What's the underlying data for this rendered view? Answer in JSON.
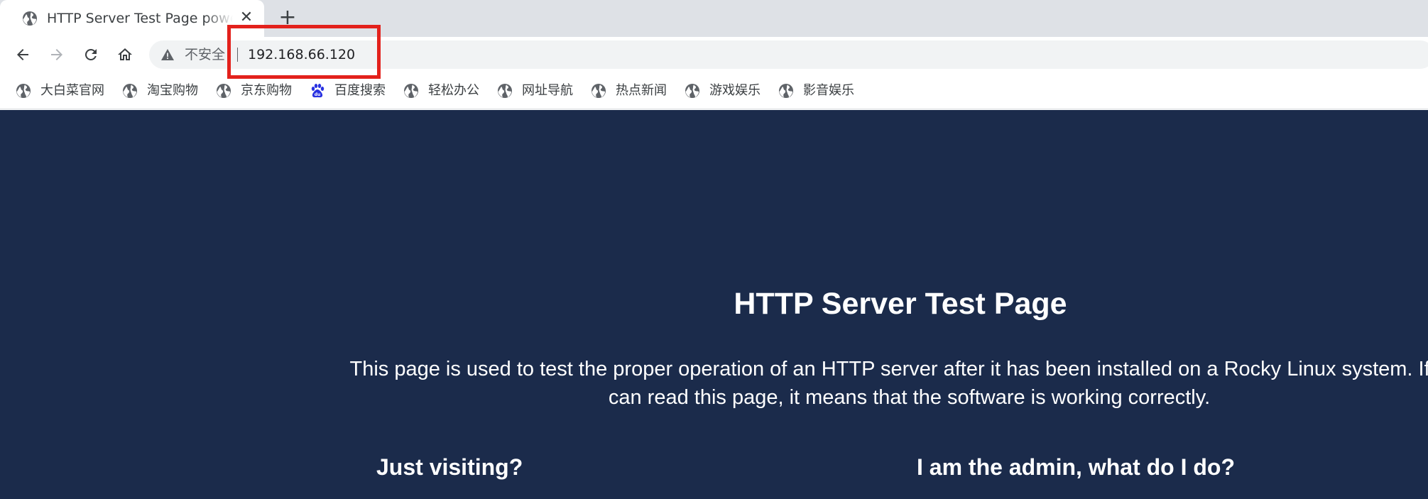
{
  "tab": {
    "title": "HTTP Server Test Page powered by Rocky Linux",
    "close_glyph": "✕",
    "favicon": "globe-icon"
  },
  "new_tab_glyph": "+",
  "toolbar": {
    "back_icon": "back-arrow-icon",
    "forward_icon": "forward-arrow-icon",
    "reload_icon": "reload-icon",
    "home_icon": "home-icon"
  },
  "omnibox": {
    "security_icon": "warning-triangle-icon",
    "security_label": "不安全",
    "url": "192.168.66.120"
  },
  "bookmarks": [
    {
      "label": "大白菜官网",
      "icon": "globe-icon"
    },
    {
      "label": "淘宝购物",
      "icon": "globe-icon"
    },
    {
      "label": "京东购物",
      "icon": "globe-icon"
    },
    {
      "label": "百度搜索",
      "icon": "baidu-paw-icon"
    },
    {
      "label": "轻松办公",
      "icon": "globe-icon"
    },
    {
      "label": "网址导航",
      "icon": "globe-icon"
    },
    {
      "label": "热点新闻",
      "icon": "globe-icon"
    },
    {
      "label": "游戏娱乐",
      "icon": "globe-icon"
    },
    {
      "label": "影音娱乐",
      "icon": "globe-icon"
    }
  ],
  "page": {
    "title": "HTTP Server Test Page",
    "description": "This page is used to test the proper operation of an HTTP server after it has been installed on a Rocky Linux system. If you can read this page, it means that the software is working correctly.",
    "section_left_heading": "Just visiting?",
    "section_right_heading": "I am the admin, what do I do?"
  },
  "colors": {
    "page_background": "#1b2b4b",
    "tabstrip_background": "#dee1e6",
    "omnibox_background": "#f1f3f4",
    "highlight_red": "#e3211c",
    "baidu_blue": "#2932e1"
  }
}
